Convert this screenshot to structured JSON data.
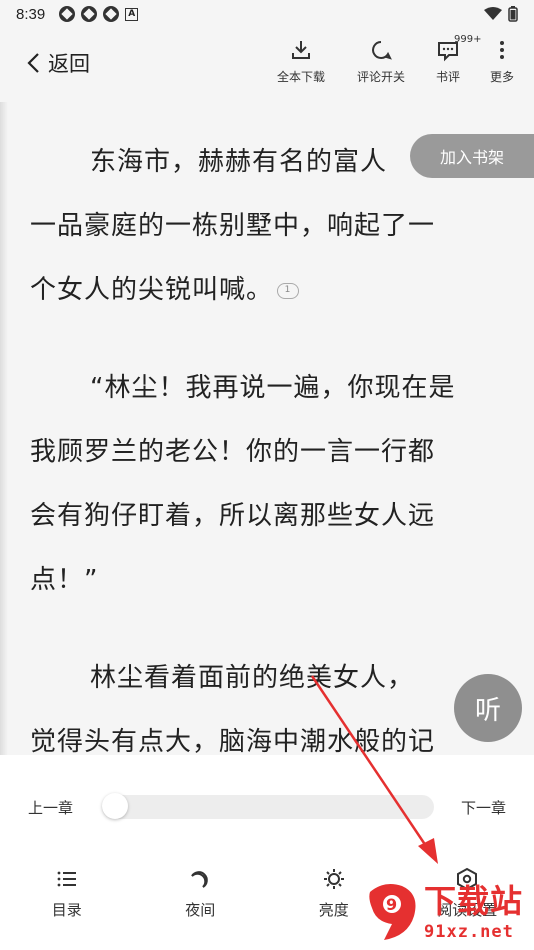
{
  "status_bar": {
    "time": "8:39"
  },
  "top_bar": {
    "back_label": "返回",
    "actions": [
      {
        "label": "全本下载",
        "icon": "download-icon"
      },
      {
        "label": "评论开关",
        "icon": "comment-toggle-icon"
      },
      {
        "label": "书评",
        "icon": "book-review-icon",
        "badge": "999+"
      },
      {
        "label": "更多",
        "icon": "more-vertical-icon"
      }
    ]
  },
  "reader": {
    "top_fragment": "…",
    "paragraphs": [
      {
        "lines": [
          "东海市，赫赫有名的富人",
          "一品豪庭的一栋别墅中，响起了一",
          "个女人的尖锐叫喊。"
        ],
        "comment_count": "1"
      },
      {
        "lines": [
          "“林尘！我再说一遍，你现在是",
          "我顾罗兰的老公！你的一言一行都",
          "会有狗仔盯着，所以离那些女人远",
          "点！”"
        ]
      },
      {
        "lines": [
          "林尘看着面前的绝美女人，",
          "觉得头有点大，脑海中潮水般的记"
        ]
      }
    ]
  },
  "add_to_shelf": "加入书架",
  "listen": "听",
  "bottom_panel": {
    "prev_chapter": "上一章",
    "next_chapter": "下一章",
    "progress": 0,
    "tools": [
      {
        "label": "目录",
        "icon": "list-icon"
      },
      {
        "label": "夜间",
        "icon": "moon-icon"
      },
      {
        "label": "亮度",
        "icon": "brightness-icon"
      },
      {
        "label": "阅读设置",
        "icon": "settings-hexagon-icon"
      }
    ]
  },
  "watermark": {
    "title": "下载站",
    "domain": "91xz.net",
    "logo_text": "9"
  },
  "colors": {
    "accent_red": "#e53030",
    "overlay_gray": "#9a9a9a",
    "page_bg": "#f5f5f5"
  }
}
